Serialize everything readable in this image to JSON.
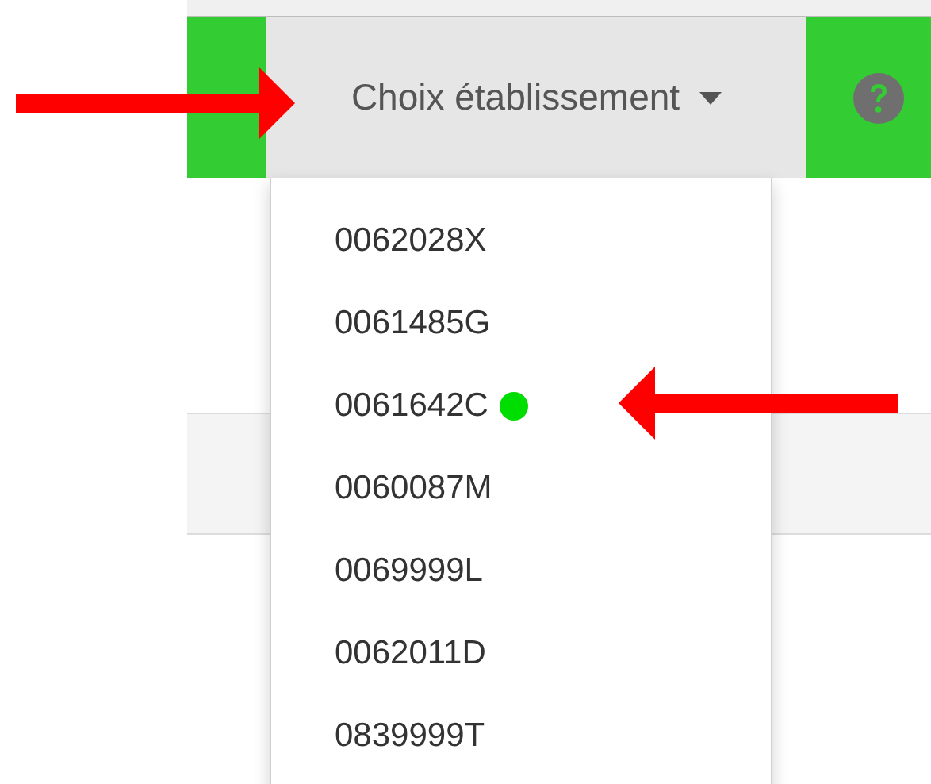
{
  "navbar": {
    "dropdown": {
      "label": "Choix établissement",
      "expanded": true,
      "items": [
        {
          "label": "0062028X",
          "current": false
        },
        {
          "label": "0061485G",
          "current": false
        },
        {
          "label": "0061642C",
          "current": true
        },
        {
          "label": "0060087M",
          "current": false
        },
        {
          "label": "0069999L",
          "current": false
        },
        {
          "label": "0062011D",
          "current": false
        },
        {
          "label": "0839999T",
          "current": false
        }
      ]
    }
  }
}
